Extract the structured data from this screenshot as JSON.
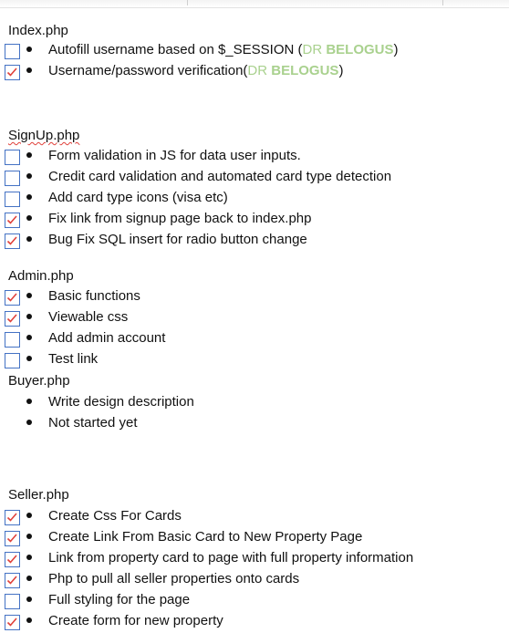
{
  "sections": [
    {
      "title": "Index.php",
      "items": [
        {
          "checked": false,
          "text": "Autofill username based on $_SESSION  (",
          "note_pre": "DR ",
          "note_bold": "BELOGUS",
          "suffix": ")"
        },
        {
          "checked": true,
          "text": "Username/password verification(",
          "note_pre": "DR ",
          "note_bold": "BELOGUS",
          "suffix": ")"
        }
      ]
    },
    {
      "title": "SignUp.php",
      "items": [
        {
          "checked": false,
          "text": "Form validation in JS for data user inputs."
        },
        {
          "checked": false,
          "text": "Credit card validation and automated card type detection"
        },
        {
          "checked": false,
          "text": "Add card type icons (visa etc)"
        },
        {
          "checked": true,
          "text": "Fix link from signup page back to index.php"
        },
        {
          "checked": true,
          "text": "Bug Fix SQL insert for radio button change"
        }
      ]
    },
    {
      "title": "Admin.php",
      "items": [
        {
          "checked": true,
          "text": "Basic functions"
        },
        {
          "checked": true,
          "text": "Viewable css"
        },
        {
          "checked": false,
          "text": "Add admin account"
        },
        {
          "checked": false,
          "text": "Test link"
        }
      ]
    },
    {
      "title": "Buyer.php",
      "items": [
        {
          "checked": null,
          "text": "Write design description"
        },
        {
          "checked": null,
          "text": "Not started yet"
        }
      ]
    },
    {
      "title": "Seller.php",
      "items": [
        {
          "checked": true,
          "text": "Create Css For Cards"
        },
        {
          "checked": true,
          "text": "Create Link From Basic Card to New Property Page"
        },
        {
          "checked": true,
          "text": "Link from property card to page with full property information"
        },
        {
          "checked": true,
          "text": "Php to pull all seller properties onto cards"
        },
        {
          "checked": false,
          "text": "Full styling for the page"
        },
        {
          "checked": true,
          "text": "Create form for new property"
        }
      ]
    }
  ],
  "colors": {
    "checkbox_border": "#4472c4",
    "checkmark": "#e0403a",
    "note": "#a9d18e",
    "spellcheck": "#e0403a"
  }
}
